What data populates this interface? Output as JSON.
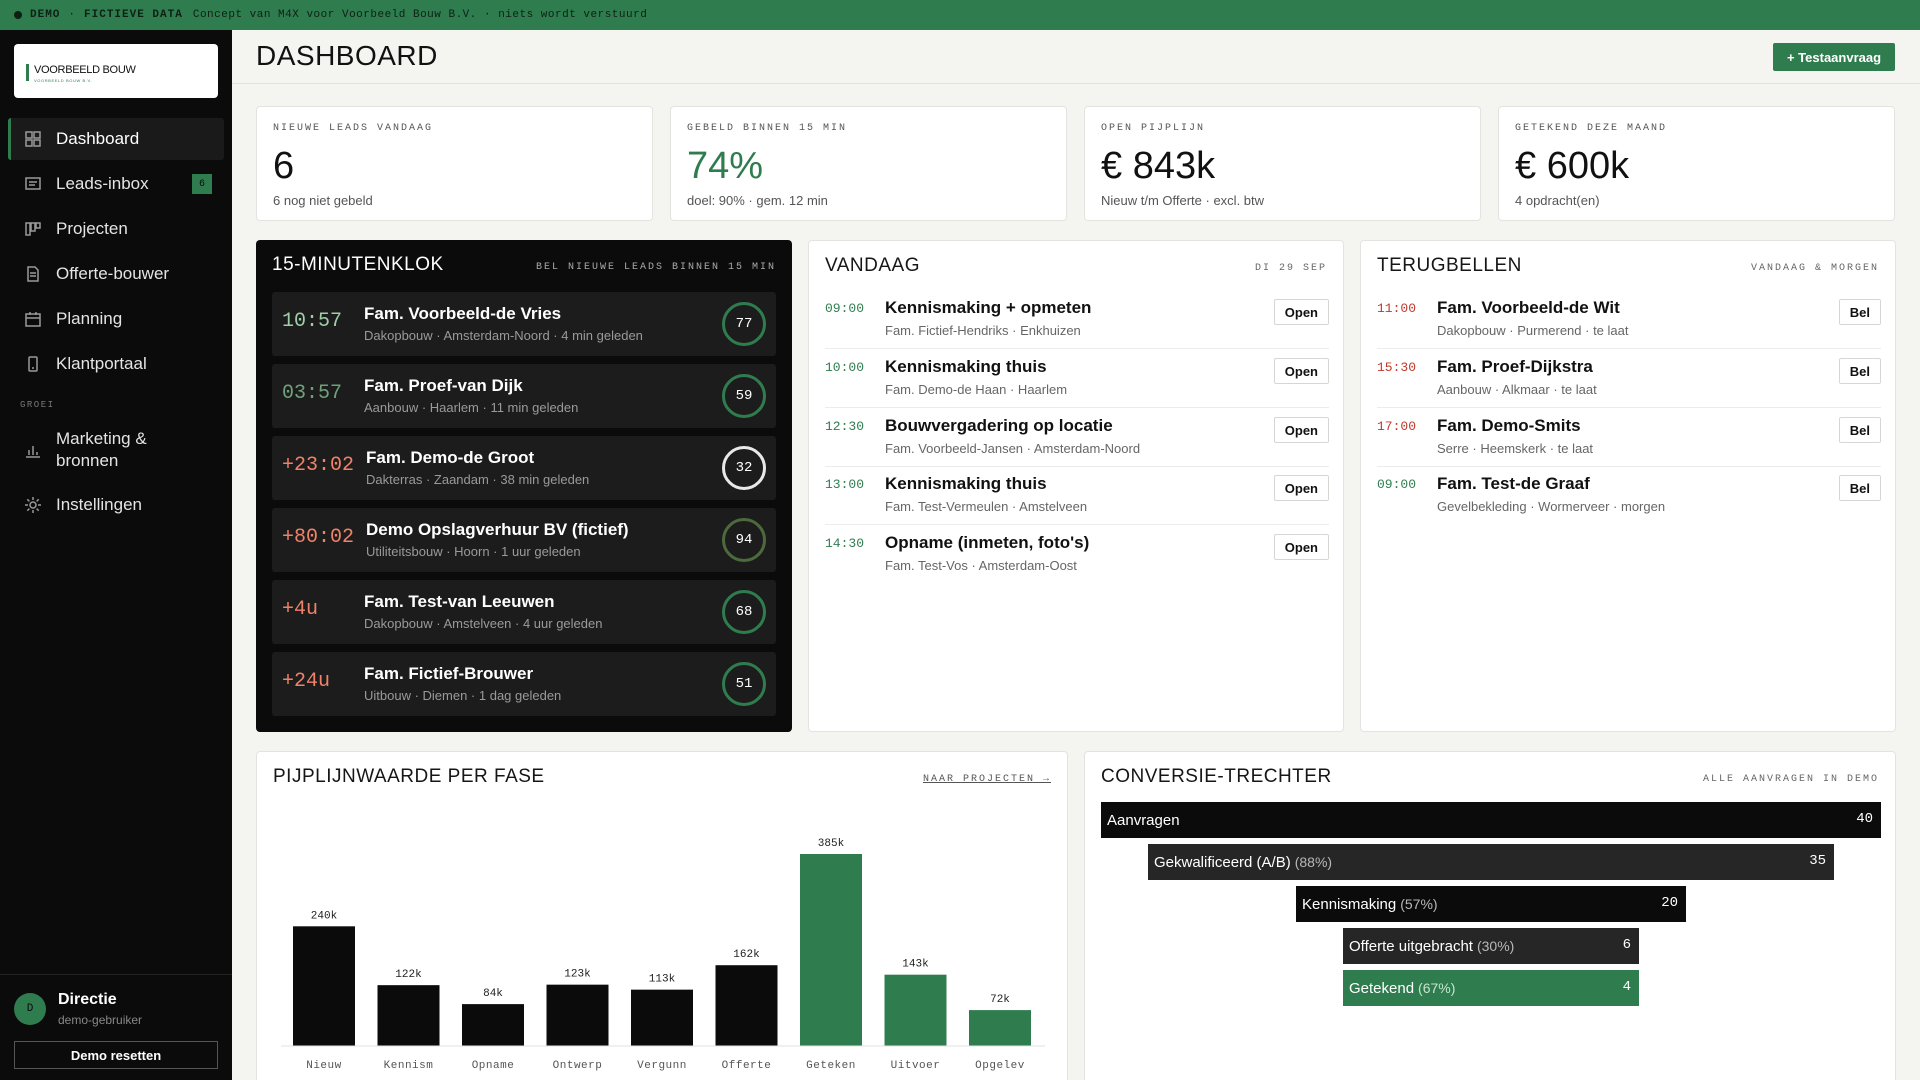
{
  "banner": {
    "label_demo": "DEMO",
    "label_data": "FICTIEVE DATA",
    "text": "Concept van M4X voor Voorbeeld Bouw B.V. · niets wordt verstuurd"
  },
  "brand": {
    "name": "VOORBEELD BOUW",
    "sub": "VOORBEELD BOUW B.V."
  },
  "sidebar": {
    "items": [
      {
        "label": "Dashboard",
        "icon": "dashboard-icon",
        "active": true
      },
      {
        "label": "Leads-inbox",
        "icon": "inbox-icon",
        "badge": "6"
      },
      {
        "label": "Projecten",
        "icon": "kanban-icon"
      },
      {
        "label": "Offerte-bouwer",
        "icon": "document-icon"
      },
      {
        "label": "Planning",
        "icon": "calendar-icon"
      },
      {
        "label": "Klantportaal",
        "icon": "phone-icon"
      }
    ],
    "section_label": "GROEI",
    "growth_items": [
      {
        "label": "Marketing & bronnen",
        "icon": "bar-chart-icon"
      },
      {
        "label": "Instellingen",
        "icon": "gear-icon"
      }
    ],
    "user": {
      "initial": "D",
      "name": "Directie",
      "role": "demo-gebruiker"
    },
    "reset_label": "Demo resetten"
  },
  "header": {
    "title": "DASHBOARD",
    "button_label": "+ Testaanvraag"
  },
  "kpis": [
    {
      "label": "NIEUWE LEADS VANDAAG",
      "value": "6",
      "sub": "6 nog niet gebeld"
    },
    {
      "label": "GEBELD BINNEN 15 MIN",
      "value": "74%",
      "sub": "doel: 90% · gem. 12 min"
    },
    {
      "label": "OPEN PIJPLIJN",
      "value": "€ 843k",
      "sub": "Nieuw t/m Offerte · excl. btw"
    },
    {
      "label": "GETEKEND DEZE MAAND",
      "value": "€ 600k",
      "sub": "4 opdracht(en)"
    }
  ],
  "clock": {
    "title": "15-MINUTENKLOK",
    "meta": "BEL NIEUWE LEADS BINNEN 15 MIN",
    "rows": [
      {
        "time": "10:57",
        "name": "Fam. Voorbeeld-de Vries",
        "meta": "Dakopbouw · Amsterdam-Noord · 4 min geleden",
        "score": "77"
      },
      {
        "time": "03:57",
        "name": "Fam. Proef-van Dijk",
        "meta": "Aanbouw · Haarlem · 11 min geleden",
        "score": "59"
      },
      {
        "time": "+23:02",
        "name": "Fam. Demo-de Groot",
        "meta": "Dakterras · Zaandam · 38 min geleden",
        "score": "32"
      },
      {
        "time": "+80:02",
        "name": "Demo Opslagverhuur BV (fictief)",
        "meta": "Utiliteitsbouw · Hoorn · 1 uur geleden",
        "score": "94"
      },
      {
        "time": "+4u",
        "name": "Fam. Test-van Leeuwen",
        "meta": "Dakopbouw · Amstelveen · 4 uur geleden",
        "score": "68"
      },
      {
        "time": "+24u",
        "name": "Fam. Fictief-Brouwer",
        "meta": "Uitbouw · Diemen · 1 dag geleden",
        "score": "51"
      }
    ]
  },
  "today": {
    "title": "VANDAAG",
    "meta": "DI 29 SEP",
    "button_label": "Open",
    "rows": [
      {
        "time": "09:00",
        "title": "Kennismaking + opmeten",
        "sub": "Fam. Fictief-Hendriks · Enkhuizen"
      },
      {
        "time": "10:00",
        "title": "Kennismaking thuis",
        "sub": "Fam. Demo-de Haan · Haarlem"
      },
      {
        "time": "12:30",
        "title": "Bouwvergadering op locatie",
        "sub": "Fam. Voorbeeld-Jansen · Amsterdam-Noord"
      },
      {
        "time": "13:00",
        "title": "Kennismaking thuis",
        "sub": "Fam. Test-Vermeulen · Amstelveen"
      },
      {
        "time": "14:30",
        "title": "Opname (inmeten, foto's)",
        "sub": "Fam. Test-Vos · Amsterdam-Oost"
      }
    ]
  },
  "callback": {
    "title": "TERUGBELLEN",
    "meta": "VANDAAG & MORGEN",
    "button_label": "Bel",
    "rows": [
      {
        "time": "11:00",
        "title": "Fam. Voorbeeld-de Wit",
        "sub": "Dakopbouw · Purmerend · te laat"
      },
      {
        "time": "15:30",
        "title": "Fam. Proef-Dijkstra",
        "sub": "Aanbouw · Alkmaar · te laat"
      },
      {
        "time": "17:00",
        "title": "Fam. Demo-Smits",
        "sub": "Serre · Heemskerk · te laat"
      },
      {
        "time": "09:00",
        "title": "Fam. Test-de Graaf",
        "sub": "Gevelbekleding · Wormerveer · morgen"
      }
    ]
  },
  "pipeline": {
    "title": "PIJPLIJNWAARDE PER FASE",
    "link": "NAAR PROJECTEN →"
  },
  "funnel": {
    "title": "CONVERSIE-TRECHTER",
    "meta": "ALLE AANVRAGEN IN DEMO",
    "stages": [
      {
        "label": "Aanvragen",
        "pct": "",
        "count": "40"
      },
      {
        "label": "Gekwalificeerd (A/B)",
        "pct": "(88%)",
        "count": "35"
      },
      {
        "label": "Kennismaking",
        "pct": "(57%)",
        "count": "20"
      },
      {
        "label": "Offerte uitgebracht",
        "pct": "(30%)",
        "count": "6"
      },
      {
        "label": "Getekend",
        "pct": "(67%)",
        "count": "4"
      }
    ]
  },
  "colors": {
    "accent": "#2f7d4f",
    "dark": "#0b0b0b",
    "late": "#f0826a"
  },
  "chart_data": {
    "type": "bar",
    "title": "PIJPLIJNWAARDE PER FASE",
    "categories": [
      "Nieuw",
      "Kennism",
      "Opname",
      "Ontwerp",
      "Vergunn",
      "Offerte",
      "Geteken",
      "Uitvoer",
      "Opgelev"
    ],
    "values": [
      240,
      122,
      84,
      123,
      113,
      162,
      385,
      143,
      72
    ],
    "value_labels": [
      "240k",
      "122k",
      "84k",
      "123k",
      "113k",
      "162k",
      "385k",
      "143k",
      "72k"
    ],
    "bar_colors": [
      "#0b0b0b",
      "#0b0b0b",
      "#0b0b0b",
      "#0b0b0b",
      "#0b0b0b",
      "#0b0b0b",
      "#2f7d4f",
      "#2f7d4f",
      "#2f7d4f"
    ],
    "ylim": [
      0,
      385
    ],
    "grid": false,
    "legend": "none"
  }
}
